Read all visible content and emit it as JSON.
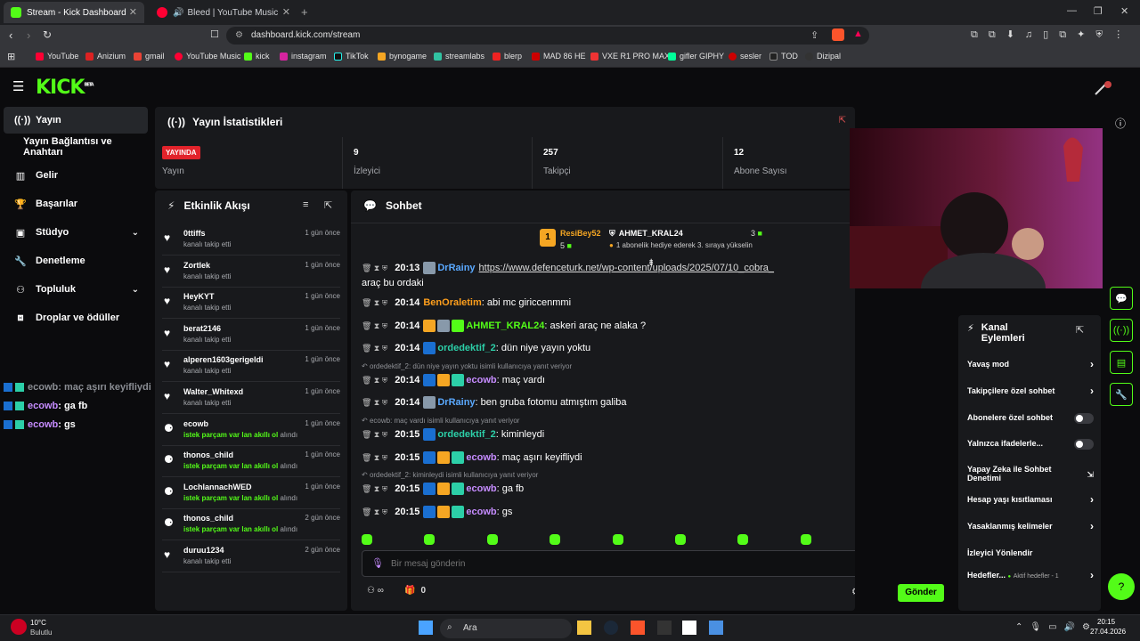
{
  "browser": {
    "tabs": [
      {
        "title": "Stream - Kick Dashboard",
        "active": true
      },
      {
        "title": "Bleed | YouTube Music",
        "active": false
      }
    ],
    "url": "dashboard.kick.com/stream",
    "bookmarks": [
      "YouTube",
      "Anizium",
      "gmail",
      "YouTube Music",
      "kick",
      "instagram",
      "TikTok",
      "bynogame",
      "streamlabs",
      "blerp",
      "MAD 86 HE",
      "VXE R1 PRO MAX",
      "gifler GIPHY",
      "sesler",
      "TOD",
      "Dizipal"
    ]
  },
  "sidebar": {
    "items": [
      {
        "label": "Yayın",
        "icon": "broadcast-icon"
      },
      {
        "label": "Yayın Bağlantısı ve Anahtarı"
      },
      {
        "label": "Gelir",
        "icon": "chart-icon"
      },
      {
        "label": "Başarılar",
        "icon": "trophy-icon"
      },
      {
        "label": "Stüdyo",
        "icon": "studio-icon"
      },
      {
        "label": "Denetleme",
        "icon": "wrench-icon"
      },
      {
        "label": "Topluluk",
        "icon": "community-icon"
      },
      {
        "label": "Droplar ve ödüller",
        "icon": "drops-icon"
      }
    ]
  },
  "overlay_chat": [
    {
      "user": "ecowb",
      "text": ": maç aşırı keyifliydi"
    },
    {
      "user": "ecowb",
      "text": " : ga fb"
    },
    {
      "user": "ecowb",
      "text": " : gs"
    }
  ],
  "stats": {
    "title": "Yayın İstatistikleri",
    "live_badge": "YAYINDA",
    "cells": [
      {
        "value": "",
        "label": "Yayın"
      },
      {
        "value": "9",
        "label": "İzleyici"
      },
      {
        "value": "257",
        "label": "Takipçi"
      },
      {
        "value": "12",
        "label": "Abone Sayısı"
      }
    ]
  },
  "activity": {
    "title": "Etkinlik Akışı",
    "items": [
      {
        "name": "0ttiffs",
        "text": "kanalı takip etti",
        "time": "1 gün önce",
        "type": "follow"
      },
      {
        "name": "Zortlek",
        "text": "kanalı takip etti",
        "time": "1 gün önce",
        "type": "follow"
      },
      {
        "name": "HeyKYT",
        "text": "kanalı takip etti",
        "time": "1 gün önce",
        "type": "follow"
      },
      {
        "name": "berat2146",
        "text": "kanalı takip etti",
        "time": "1 gün önce",
        "type": "follow"
      },
      {
        "name": "alperen1603gerigeldi",
        "text": "kanalı takip etti",
        "time": "1 gün önce",
        "type": "follow"
      },
      {
        "name": "Walter_Whitexd",
        "text": "kanalı takip etti",
        "time": "1 gün önce",
        "type": "follow"
      },
      {
        "name": "ecowb",
        "text": "istek parçam var lan akıllı ol",
        "suffix": "alındı",
        "time": "1 gün önce",
        "type": "reward"
      },
      {
        "name": "thonos_child",
        "text": "istek parçam var lan akıllı ol",
        "suffix": "alındı",
        "time": "1 gün önce",
        "type": "reward"
      },
      {
        "name": "LochlannachWED",
        "text": "istek parçam var lan akıllı ol",
        "suffix": "alındı",
        "time": "1 gün önce",
        "type": "reward"
      },
      {
        "name": "thonos_child",
        "text": "istek parçam var lan akıllı ol",
        "suffix": "alındı",
        "time": "2 gün önce",
        "type": "reward"
      },
      {
        "name": "duruu1234",
        "text": "kanalı takip etti",
        "time": "2 gün önce",
        "type": "follow"
      }
    ]
  },
  "chat": {
    "title": "Sohbet",
    "pinned": {
      "user1": "ResiBey52",
      "user1_count": "5",
      "user2": "AHMET_KRAL24",
      "user2_count": "3",
      "rank": "1",
      "note": "1 abonelik hediye ederek 3. sıraya yükselin"
    },
    "partial_top": {
      "time": "20:13",
      "user": "DrRainy",
      "text": "https://www.defenceturk.net/wp-content/uploads/2025/07/10_cobra_",
      "cont": "araç bu ordaki"
    },
    "messages": [
      {
        "time": "20:14",
        "user": "BenOraletim",
        "color": "#ff9f1c",
        "text": ": abi mc giriccenmmi",
        "reply": ""
      },
      {
        "time": "20:14",
        "user": "AHMET_KRAL24",
        "color": "#53fc18",
        "text": ": askeri araç ne alaka ?",
        "reply": ""
      },
      {
        "time": "20:14",
        "user": "ordedektif_2",
        "color": "#2ccfa8",
        "text": ": dün niye yayın yoktu",
        "reply": ""
      },
      {
        "time": "20:14",
        "user": "ecowb",
        "color": "#c68cff",
        "text": ": maç vardı",
        "reply": "ordedektif_2: dün niye yayın yoktu isimli kullanıcıya yanıt veriyor"
      },
      {
        "time": "20:14",
        "user": "DrRainy",
        "color": "#5aa9ff",
        "text": ": ben gruba fotomu atmıştım galiba",
        "reply": ""
      },
      {
        "time": "20:15",
        "user": "ordedektif_2",
        "color": "#2ccfa8",
        "text": ": kiminleydi",
        "reply": "ecowb: maç vardı isimli kullanıcıya yanıt veriyor"
      },
      {
        "time": "20:15",
        "user": "ecowb",
        "color": "#c68cff",
        "text": ": maç aşırı keyifliydi",
        "reply": ""
      },
      {
        "time": "20:15",
        "user": "ecowb",
        "color": "#c68cff",
        "text": ": ga fb",
        "reply": "ordedektif_2: kiminleydi isimli kullanıcıya yanıt veriyor"
      },
      {
        "time": "20:15",
        "user": "ecowb",
        "color": "#c68cff",
        "text": ": gs",
        "reply": ""
      }
    ],
    "input_placeholder": "Bir mesaj gönderin",
    "points": "0",
    "send_label": "Gönder"
  },
  "actions": {
    "title": "Kanal Eylemleri",
    "items": [
      {
        "label": "Yavaş mod",
        "control": "chevron"
      },
      {
        "label": "Takipçilere özel sohbet",
        "control": "chevron"
      },
      {
        "label": "Abonelere özel sohbet",
        "control": "toggle"
      },
      {
        "label": "Yalnızca ifadelerle...",
        "control": "toggle"
      },
      {
        "label": "Yapay Zeka ile Sohbet Denetimi",
        "control": "external"
      },
      {
        "label": "Hesap yaşı kısıtlaması",
        "control": "chevron"
      },
      {
        "label": "Yasaklanmış kelimeler",
        "control": "chevron"
      },
      {
        "label": "İzleyici Yönlendir",
        "control": "none"
      },
      {
        "label": "Hedefler...",
        "control": "chevron",
        "extra": "Aktif hedefler - 1"
      }
    ]
  },
  "taskbar": {
    "weather_temp": "10°C",
    "weather_text": "Bulutlu",
    "search": "Ara",
    "time": "20:15",
    "date": "27.04.2026"
  },
  "colors": {
    "accent": "#53fc18",
    "panel": "#18191c",
    "bg": "#0b0b0d"
  }
}
